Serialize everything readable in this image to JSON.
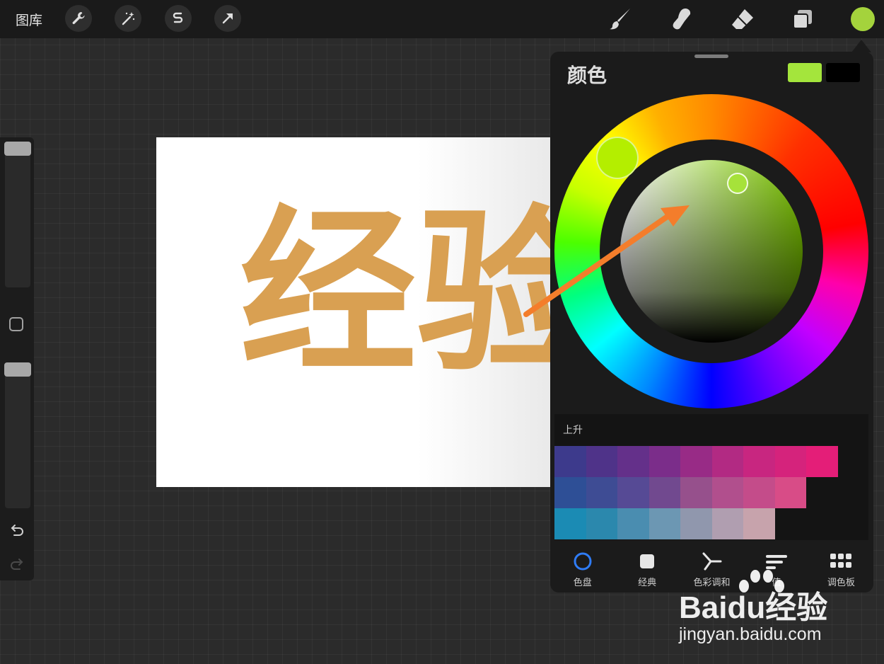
{
  "topbar": {
    "gallery_label": "图库"
  },
  "document": {
    "text": "经验"
  },
  "color_panel": {
    "title": "颜色",
    "primary_color": "#a4e53c",
    "secondary_color": "#000000",
    "palette": {
      "name": "上升",
      "rows": [
        [
          "#3d3a8c",
          "#4f3389",
          "#64308a",
          "#7b2d8a",
          "#982b86",
          "#b22a83",
          "#c82680",
          "#d5237c",
          "#e41e78"
        ],
        [
          "#2e4f96",
          "#3e4c94",
          "#564a95",
          "#71498f",
          "#96508c",
          "#b14f8d",
          "#c44c8a",
          "#d84c87"
        ],
        [
          "#1b8bb4",
          "#2b88ad",
          "#4a8db0",
          "#6c97b3",
          "#9097ad",
          "#b09eb0",
          "#c7a3ac"
        ]
      ]
    },
    "tabs": [
      {
        "label": "色盘",
        "icon": "disc-icon",
        "active": true
      },
      {
        "label": "经典",
        "icon": "square-icon",
        "active": false
      },
      {
        "label": "色彩调和",
        "icon": "harmony-icon",
        "active": false
      },
      {
        "label": "值",
        "icon": "value-bars-icon",
        "active": false
      },
      {
        "label": "调色板",
        "icon": "palette-grid-icon",
        "active": false
      }
    ]
  },
  "watermark": {
    "logo": "Baidu经验",
    "url": "jingyan.baidu.com"
  }
}
